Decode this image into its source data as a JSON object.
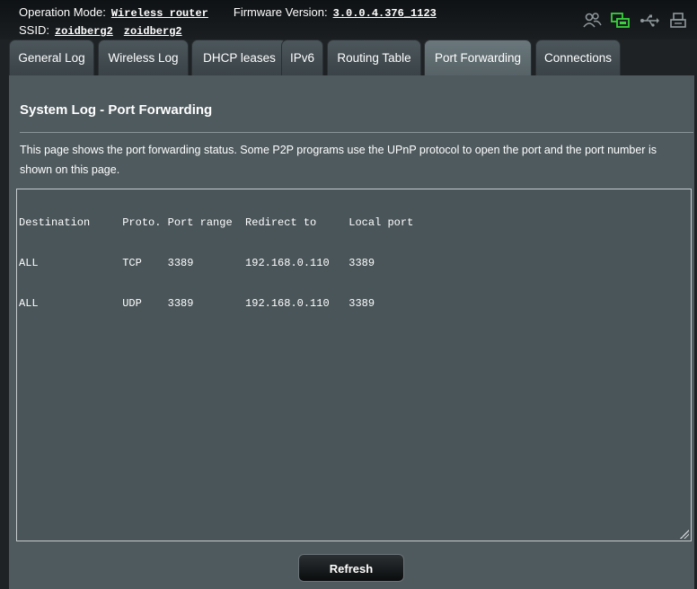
{
  "header": {
    "operation_mode_label": "Operation Mode:",
    "operation_mode_value": "Wireless router",
    "firmware_label": "Firmware Version:",
    "firmware_value": "3.0.0.4.376_1123",
    "ssid_label": "SSID:",
    "ssid_values": [
      "zoidberg2",
      "zoidberg2"
    ],
    "status_icons": [
      "clients-icon",
      "network-icon",
      "usb-icon",
      "printer-icon"
    ],
    "network_icon_color": "#39d23c",
    "icon_color": "#8f999d"
  },
  "tabs": [
    {
      "label": "General Log",
      "active": false
    },
    {
      "label": "Wireless Log",
      "active": false
    },
    {
      "label": "DHCP leases",
      "active": false
    },
    {
      "label": "IPv6",
      "active": false
    },
    {
      "label": "Routing Table",
      "active": false
    },
    {
      "label": "Port Forwarding",
      "active": true
    },
    {
      "label": "Connections",
      "active": false
    }
  ],
  "main": {
    "title": "System Log - Port Forwarding",
    "description": "This page shows the port forwarding status. Some P2P programs use the UPnP protocol to open the port and the port number is shown on this page.",
    "log_lines": [
      "Destination     Proto. Port range  Redirect to     Local port",
      "ALL             TCP    3389        192.168.0.110   3389",
      "ALL             UDP    3389        192.168.0.110   3389"
    ],
    "refresh_label": "Refresh"
  }
}
